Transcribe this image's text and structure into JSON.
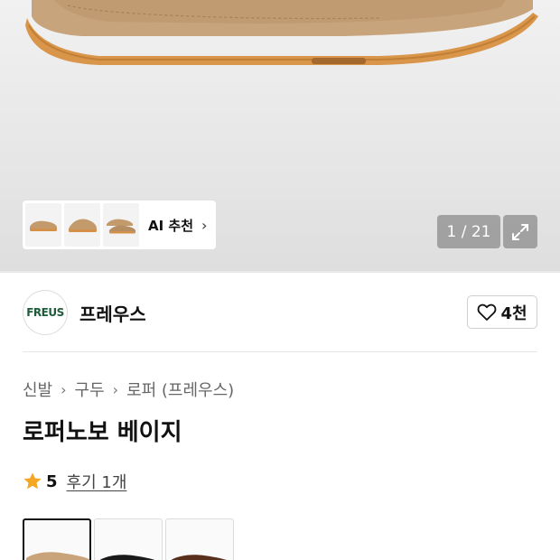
{
  "gallery": {
    "counter": "1 / 21",
    "thumbnails": [
      "loafer-beige-side",
      "loafer-beige-angle",
      "loafer-beige-pair"
    ],
    "ai_recommend_label": "AI 추천"
  },
  "brand": {
    "logo_text": "FREUS",
    "name": "프레우스",
    "like_count": "4천"
  },
  "breadcrumb": [
    "신발",
    "구두",
    "로퍼 (프레우스)"
  ],
  "product": {
    "title": "로퍼노보 베이지",
    "rating": "5",
    "review_link": "후기 1개"
  },
  "colors": {
    "accent": "#f5a623",
    "swatches": [
      {
        "name": "beige",
        "color": "#c9a47a",
        "selected": true
      },
      {
        "name": "black",
        "color": "#1a1a1a",
        "selected": false
      },
      {
        "name": "brown",
        "color": "#5a2f1c",
        "selected": false
      }
    ]
  }
}
